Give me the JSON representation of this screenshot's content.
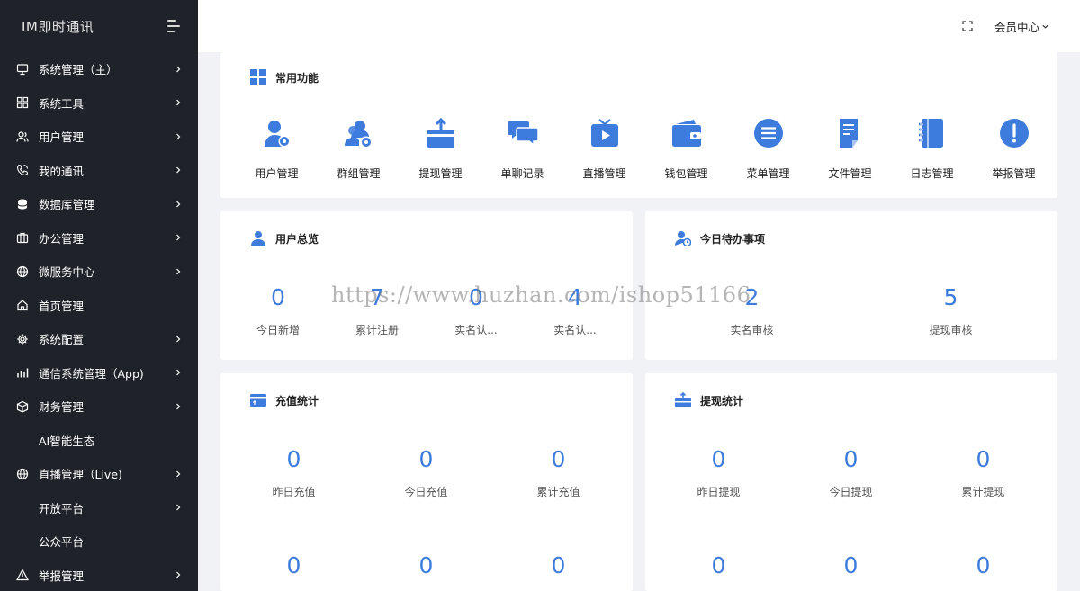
{
  "app": {
    "title": "IM即时通讯"
  },
  "sidebar": {
    "items": [
      {
        "label": "系统管理（主）",
        "icon": "monitor-icon",
        "has_arrow": true
      },
      {
        "label": "系统工具",
        "icon": "grid-icon",
        "has_arrow": true
      },
      {
        "label": "用户管理",
        "icon": "users-icon",
        "has_arrow": true
      },
      {
        "label": "我的通讯",
        "icon": "phone-icon",
        "has_arrow": true
      },
      {
        "label": "数据库管理",
        "icon": "database-icon",
        "has_arrow": true
      },
      {
        "label": "办公管理",
        "icon": "briefcase-icon",
        "has_arrow": true
      },
      {
        "label": "微服务中心",
        "icon": "globe-icon",
        "has_arrow": true
      },
      {
        "label": "首页管理",
        "icon": "home-icon",
        "has_arrow": false
      },
      {
        "label": "系统配置",
        "icon": "gear-icon",
        "has_arrow": true
      },
      {
        "label": "通信系统管理（App)",
        "icon": "bar-chart-icon",
        "has_arrow": true
      },
      {
        "label": "财务管理",
        "icon": "box-icon",
        "has_arrow": true
      },
      {
        "label": "AI智能生态",
        "icon": "",
        "has_arrow": false
      },
      {
        "label": "直播管理（Live)",
        "icon": "globe-icon",
        "has_arrow": true
      },
      {
        "label": "开放平台",
        "icon": "",
        "has_arrow": true
      },
      {
        "label": "公众平台",
        "icon": "",
        "has_arrow": false
      },
      {
        "label": "举报管理",
        "icon": "warning-icon",
        "has_arrow": true
      }
    ]
  },
  "header": {
    "user_menu_label": "会员中心"
  },
  "quick": {
    "title": "常用功能",
    "items": [
      {
        "label": "用户管理",
        "icon": "user-gear-icon"
      },
      {
        "label": "群组管理",
        "icon": "group-gear-icon"
      },
      {
        "label": "提现管理",
        "icon": "withdraw-tray-icon"
      },
      {
        "label": "单聊记录",
        "icon": "chat-bubbles-icon"
      },
      {
        "label": "直播管理",
        "icon": "tv-play-icon"
      },
      {
        "label": "钱包管理",
        "icon": "wallet-icon"
      },
      {
        "label": "菜单管理",
        "icon": "menu-list-icon"
      },
      {
        "label": "文件管理",
        "icon": "file-icon"
      },
      {
        "label": "日志管理",
        "icon": "notebook-icon"
      },
      {
        "label": "举报管理",
        "icon": "alert-icon"
      }
    ]
  },
  "overview": {
    "title": "用户总览",
    "stats": [
      {
        "value": "0",
        "label": "今日新增"
      },
      {
        "value": "7",
        "label": "累计注册"
      },
      {
        "value": "0",
        "label": "实名认..."
      },
      {
        "value": "4",
        "label": "实名认..."
      }
    ]
  },
  "todo": {
    "title": "今日待办事项",
    "stats": [
      {
        "value": "2",
        "label": "实名审核"
      },
      {
        "value": "5",
        "label": "提现审核"
      }
    ]
  },
  "recharge": {
    "title": "充值统计",
    "stats": [
      {
        "value": "0",
        "label": "昨日充值"
      },
      {
        "value": "0",
        "label": "今日充值"
      },
      {
        "value": "0",
        "label": "累计充值"
      }
    ],
    "stats2": [
      {
        "value": "0"
      },
      {
        "value": "0"
      },
      {
        "value": "0"
      }
    ]
  },
  "withdraw": {
    "title": "提现统计",
    "stats": [
      {
        "value": "0",
        "label": "昨日提现"
      },
      {
        "value": "0",
        "label": "今日提现"
      },
      {
        "value": "0",
        "label": "累计提现"
      }
    ],
    "stats2": [
      {
        "value": "0"
      },
      {
        "value": "0"
      },
      {
        "value": "0"
      }
    ]
  },
  "watermark": "https://www.huzhan.com/ishop51166",
  "colors": {
    "accent": "#3d7bdd",
    "sidebar_bg": "#1f2229",
    "page_bg": "#f0f2f5"
  }
}
